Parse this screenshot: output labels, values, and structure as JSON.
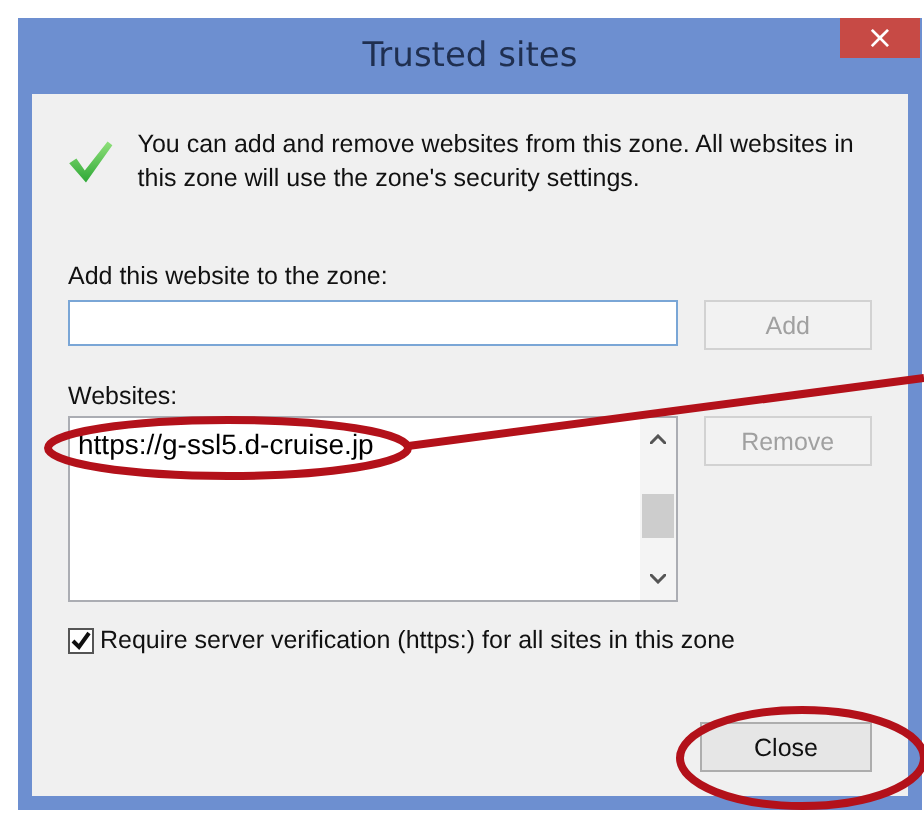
{
  "window": {
    "title": "Trusted sites",
    "close_label": "×"
  },
  "message": "You can add and remove websites from this zone. All websites in this zone will use the zone's security settings.",
  "add_field": {
    "label": "Add this website to the zone:"
  },
  "add_button": {
    "label": "Add",
    "disabled": true
  },
  "websites": {
    "label": "Websites:",
    "items": [
      {
        "url": "https://g-ssl5.d-cruise.jp",
        "selected": false
      }
    ]
  },
  "remove_button": {
    "label": "Remove",
    "disabled": true
  },
  "require_https": {
    "label": "Require server verification (https:) for all sites in this zone",
    "checked": true
  },
  "close_button": {
    "label": "Close",
    "disabled": false
  }
}
